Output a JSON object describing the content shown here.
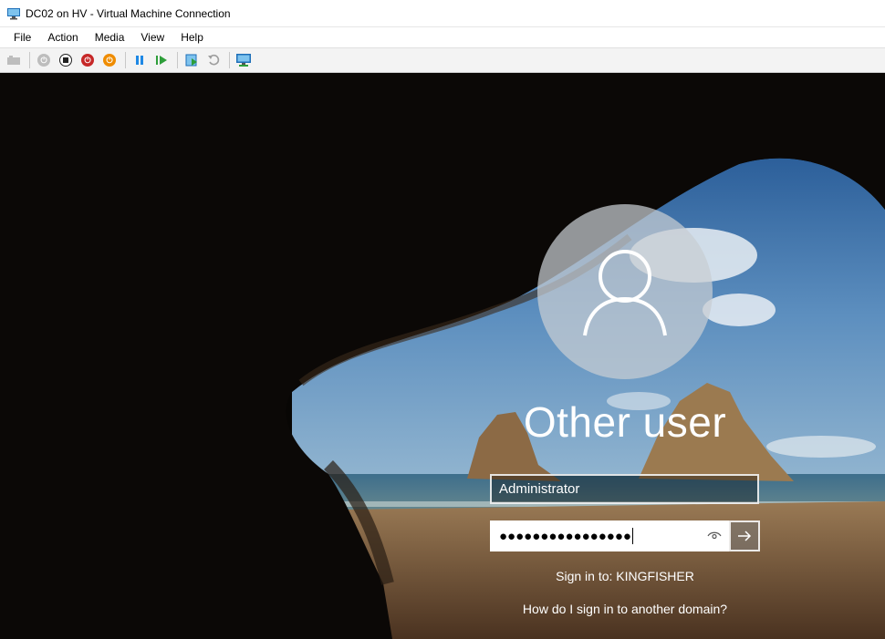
{
  "window": {
    "title": "DC02 on HV - Virtual Machine Connection"
  },
  "menu": [
    "File",
    "Action",
    "Media",
    "View",
    "Help"
  ],
  "toolbar": {
    "icons": [
      "ctrl-alt-del-icon",
      "start-icon",
      "turn-off-icon",
      "shutdown-icon",
      "save-icon",
      "pause-icon",
      "resume-icon",
      "checkpoint-icon",
      "revert-icon",
      "enhanced-session-icon"
    ]
  },
  "login": {
    "user_name": "Other user",
    "username_value": "Administrator",
    "password_value": "●●●●●●●●●●●●●●●●",
    "sign_in_to": "Sign in to: KINGFISHER",
    "other_domain_link": "How do I sign in to another domain?"
  },
  "colors": {
    "accent_green": "#2e9e3a",
    "accent_blue": "#1e88e5",
    "stop_red": "#c62828",
    "save_orange": "#ef8c00"
  }
}
